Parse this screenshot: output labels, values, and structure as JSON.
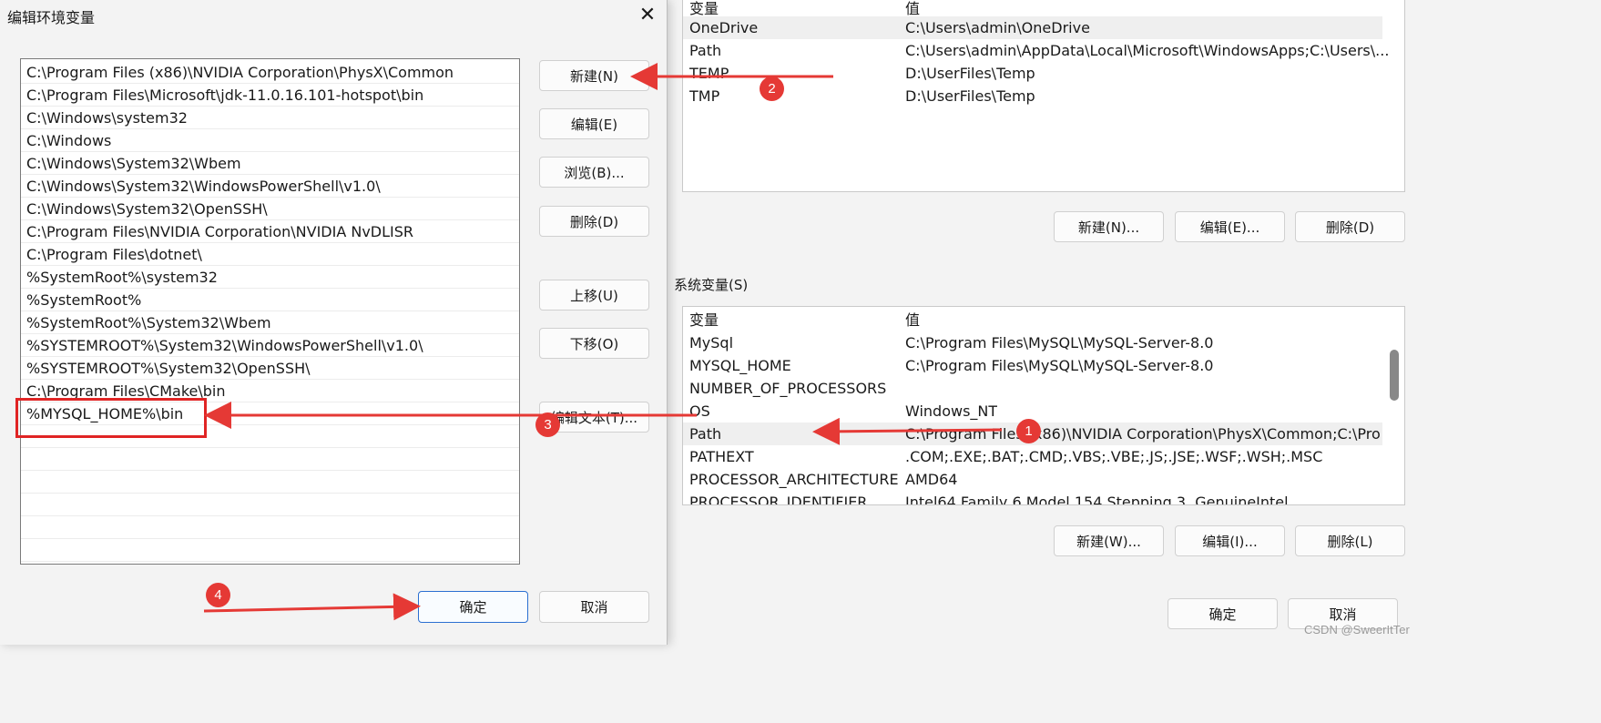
{
  "edit_dialog": {
    "title": "编辑环境变量",
    "close_icon": "close-icon",
    "paths": [
      "C:\\Program Files (x86)\\NVIDIA Corporation\\PhysX\\Common",
      "C:\\Program Files\\Microsoft\\jdk-11.0.16.101-hotspot\\bin",
      "C:\\Windows\\system32",
      "C:\\Windows",
      "C:\\Windows\\System32\\Wbem",
      "C:\\Windows\\System32\\WindowsPowerShell\\v1.0\\",
      "C:\\Windows\\System32\\OpenSSH\\",
      "C:\\Program Files\\NVIDIA Corporation\\NVIDIA NvDLISR",
      "C:\\Program Files\\dotnet\\",
      "%SystemRoot%\\system32",
      "%SystemRoot%",
      "%SystemRoot%\\System32\\Wbem",
      "%SYSTEMROOT%\\System32\\WindowsPowerShell\\v1.0\\",
      "%SYSTEMROOT%\\System32\\OpenSSH\\",
      "C:\\Program Files\\CMake\\bin",
      "%MYSQL_HOME%\\bin"
    ],
    "buttons": {
      "new": "新建(N)",
      "edit": "编辑(E)",
      "browse": "浏览(B)...",
      "delete": "删除(D)",
      "move_up": "上移(U)",
      "move_down": "下移(O)",
      "edit_text": "编辑文本(T)...",
      "ok": "确定",
      "cancel": "取消"
    }
  },
  "env_dialog": {
    "user_vars": {
      "header": [
        "变量",
        "值"
      ],
      "rows": [
        [
          "OneDrive",
          "C:\\Users\\admin\\OneDrive"
        ],
        [
          "Path",
          "C:\\Users\\admin\\AppData\\Local\\Microsoft\\WindowsApps;C:\\Users\\..."
        ],
        [
          "TEMP",
          "D:\\UserFiles\\Temp"
        ],
        [
          "TMP",
          "D:\\UserFiles\\Temp"
        ]
      ],
      "buttons": {
        "new": "新建(N)...",
        "edit": "编辑(E)...",
        "delete": "删除(D)"
      }
    },
    "system_vars": {
      "label": "系统变量(S)",
      "header": [
        "变量",
        "值"
      ],
      "rows": [
        [
          "MySql",
          "C:\\Program Files\\MySQL\\MySQL-Server-8.0"
        ],
        [
          "MYSQL_HOME",
          "C:\\Program Files\\MySQL\\MySQL-Server-8.0"
        ],
        [
          "NUMBER_OF_PROCESSORS",
          ""
        ],
        [
          "OS",
          "Windows_NT"
        ],
        [
          "Path",
          "C:\\Program Files (x86)\\NVIDIA Corporation\\PhysX\\Common;C:\\Pro..."
        ],
        [
          "PATHEXT",
          ".COM;.EXE;.BAT;.CMD;.VBS;.VBE;.JS;.JSE;.WSF;.WSH;.MSC"
        ],
        [
          "PROCESSOR_ARCHITECTURE",
          "AMD64"
        ],
        [
          "PROCESSOR_IDENTIFIER",
          "Intel64 Family 6 Model 154 Stepping 3, GenuineIntel"
        ]
      ],
      "buttons": {
        "new": "新建(W)...",
        "edit": "编辑(I)...",
        "delete": "删除(L)"
      }
    },
    "ok": "确定",
    "cancel": "取消"
  },
  "annotations": {
    "badges": [
      "1",
      "2",
      "3",
      "4"
    ],
    "color": "#e53935"
  },
  "watermark": "CSDN @SweerItTer"
}
